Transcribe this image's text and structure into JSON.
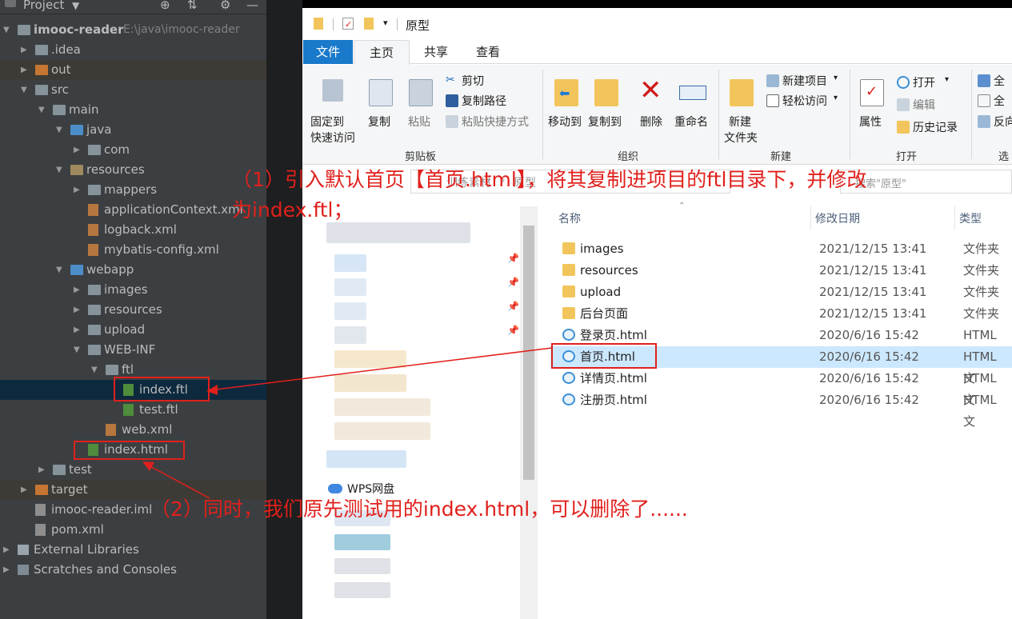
{
  "ide": {
    "tool_window_title": "Project",
    "icons": [
      "chevron-down-icon",
      "target-icon",
      "collapse-icon",
      "gear-icon",
      "minimize-icon"
    ],
    "tree": [
      {
        "label": "imooc-reader",
        "extra": "E:\\java\\imooc-reader",
        "bold": true
      },
      {
        "label": ".idea"
      },
      {
        "label": "out"
      },
      {
        "label": "src"
      },
      {
        "label": "main"
      },
      {
        "label": "java"
      },
      {
        "label": "com"
      },
      {
        "label": "resources"
      },
      {
        "label": "mappers"
      },
      {
        "label": "applicationContext.xml"
      },
      {
        "label": "logback.xml"
      },
      {
        "label": "mybatis-config.xml"
      },
      {
        "label": "webapp"
      },
      {
        "label": "images"
      },
      {
        "label": "resources"
      },
      {
        "label": "upload"
      },
      {
        "label": "WEB-INF"
      },
      {
        "label": "ftl"
      },
      {
        "label": "index.ftl"
      },
      {
        "label": "test.ftl"
      },
      {
        "label": "web.xml"
      },
      {
        "label": "index.html"
      },
      {
        "label": "test"
      },
      {
        "label": "target"
      },
      {
        "label": "imooc-reader.iml"
      },
      {
        "label": "pom.xml"
      },
      {
        "label": "External Libraries"
      },
      {
        "label": "Scratches and Consoles"
      }
    ]
  },
  "explorer": {
    "title": "原型",
    "tabs": [
      "文件",
      "主页",
      "共享",
      "查看"
    ],
    "ribbon": {
      "pin": "固定到\n快速访问",
      "pin_l1": "固定到",
      "pin_l2": "快速访问",
      "copy": "复制",
      "paste": "粘贴",
      "cut": "剪切",
      "copy_path": "复制路径",
      "paste_shortcut": "粘贴快捷方式",
      "group_clipboard": "剪贴板",
      "move_to": "移动到",
      "copy_to": "复制到",
      "delete": "删除",
      "rename": "重命名",
      "group_organize": "组织",
      "new_folder_l1": "新建",
      "new_folder_l2": "文件夹",
      "new_item": "新建项目",
      "easy_access": "轻松访问",
      "group_new": "新建",
      "properties": "属性",
      "open": "打开",
      "edit": "编辑",
      "history": "历史记录",
      "group_open": "打开",
      "select_all": "全",
      "select_none": "全",
      "invert": "反向",
      "group_select": "选"
    },
    "address": {
      "path_a": "训练素材",
      "path_b": "原型",
      "search": "搜索\"原型\""
    },
    "nav": {
      "wps": "WPS网盘"
    },
    "columns": {
      "name": "名称",
      "date": "修改日期",
      "type": "类型"
    },
    "files": [
      {
        "name": "images",
        "date": "2021/12/15 13:41",
        "type": "文件夹",
        "kind": "folder"
      },
      {
        "name": "resources",
        "date": "2021/12/15 13:41",
        "type": "文件夹",
        "kind": "folder"
      },
      {
        "name": "upload",
        "date": "2021/12/15 13:41",
        "type": "文件夹",
        "kind": "folder"
      },
      {
        "name": "后台页面",
        "date": "2021/12/15 13:41",
        "type": "文件夹",
        "kind": "folder"
      },
      {
        "name": "登录页.html",
        "date": "2020/6/16 15:42",
        "type": "HTML 文",
        "kind": "html"
      },
      {
        "name": "首页.html",
        "date": "2020/6/16 15:42",
        "type": "HTML 文",
        "kind": "html"
      },
      {
        "name": "详情页.html",
        "date": "2020/6/16 15:42",
        "type": "HTML 文",
        "kind": "html"
      },
      {
        "name": "注册页.html",
        "date": "2020/6/16 15:42",
        "type": "HTML 文",
        "kind": "html"
      }
    ],
    "selected_file": "首页.html"
  },
  "annotations": {
    "note1_line1": "（1）引入默认首页【首页.html】，将其复制进项目的ftl目录下，并修改",
    "note1_line2": "为index.ftl；",
    "note2": "（2）同时，我们原先测试用的index.html，可以删除了......",
    "color": "#e0201c"
  }
}
